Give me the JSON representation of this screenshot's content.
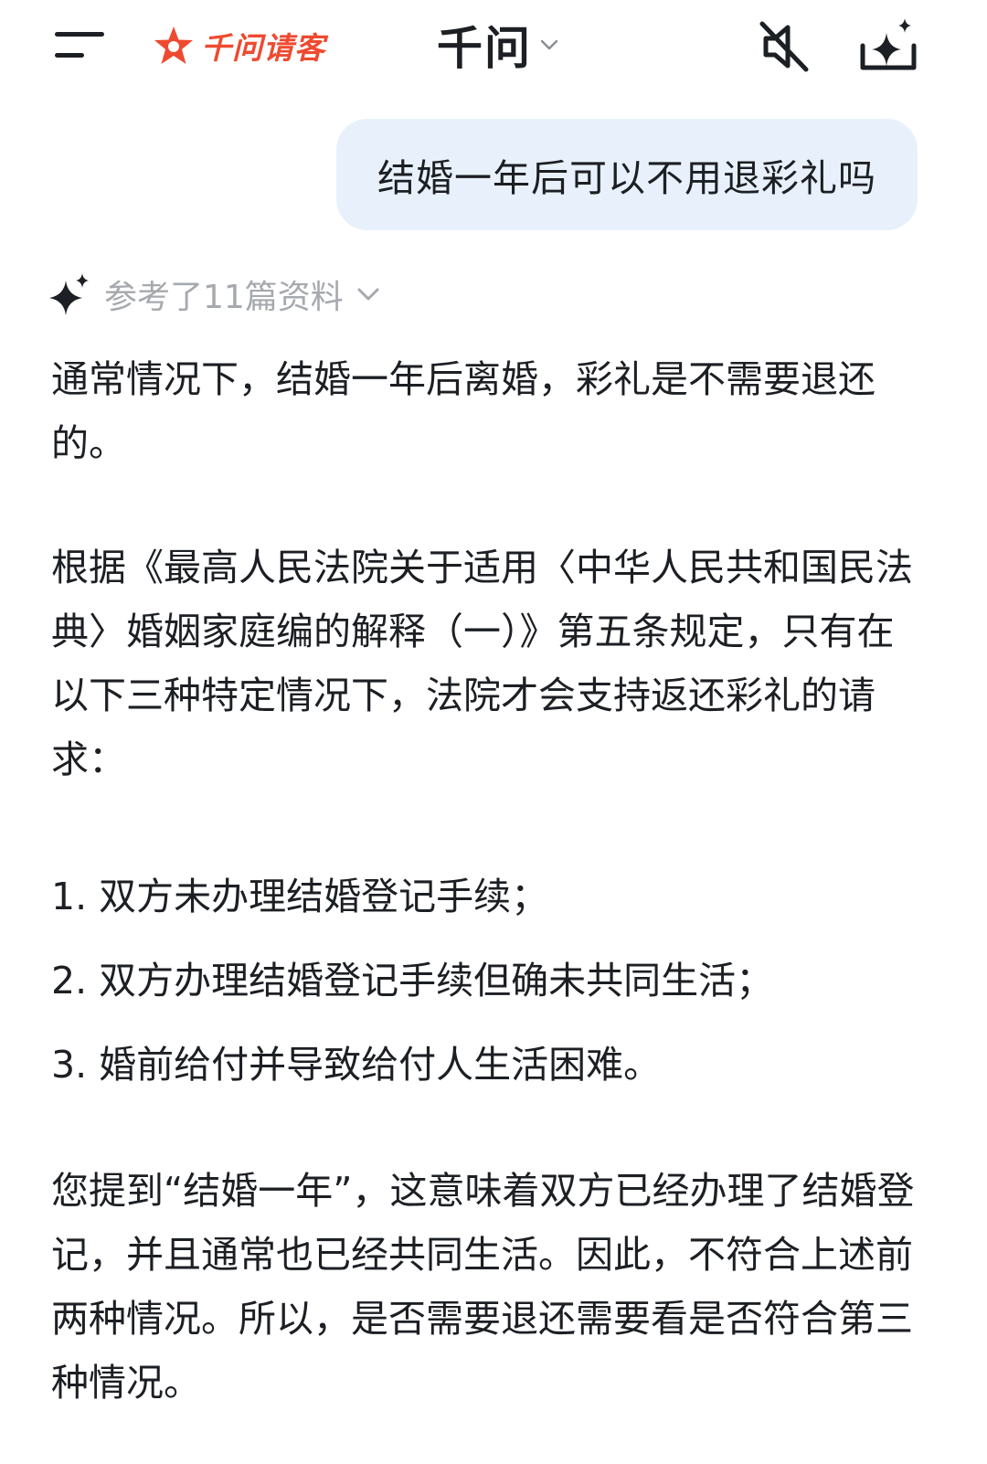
{
  "header": {
    "brand_text": "千问请客",
    "model_name": "千问",
    "icons": {
      "menu": "menu-icon",
      "brand_logo": "brand-star-icon",
      "model_chevron": "chevron-down-icon",
      "mute": "speaker-muted-icon",
      "new_chat": "new-chat-sparkle-icon"
    },
    "colors": {
      "brand": "#ee4a30",
      "text": "#1c1f23"
    }
  },
  "conversation": {
    "user_message": "结婚一年后可以不用退彩礼吗",
    "user_bubble_color": "#e8f1fb",
    "references": {
      "label": "参考了11篇资料",
      "icon": "sparkle-icon"
    },
    "answer": {
      "p1": "通常情况下，结婚一年后离婚，彩礼是不需要退还的。",
      "p2": "根据《最高人民法院关于适用〈中华人民共和国民法典〉婚姻家庭编的解释（一）》第五条规定，只有在以下三种特定情况下，法院才会支持返还彩礼的请求：",
      "list": [
        "1. 双方未办理结婚登记手续；",
        "2. 双方办理结婚登记手续但确未共同生活；",
        "3. 婚前给付并导致给付人生活困难。"
      ],
      "p3": "您提到“结婚一年”，这意味着双方已经办理了结婚登记，并且通常也已经共同生活。因此，不符合上述前两种情况。所以，是否需要退还需要看是否符合第三种情况。"
    }
  }
}
